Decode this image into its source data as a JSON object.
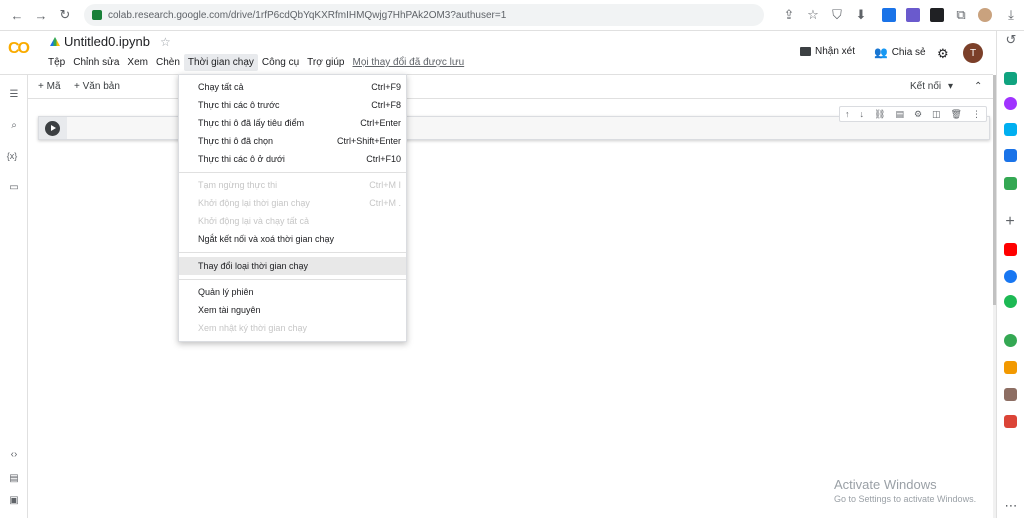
{
  "browser": {
    "url": "colab.research.google.com/drive/1rfP6cdQbYqKXRfmIHMQwjg7HhPAk2OM3?authuser=1"
  },
  "header": {
    "logo": "CO",
    "notebook_title": "Untitled0.ipynb",
    "menus": [
      "Tệp",
      "Chỉnh sửa",
      "Xem",
      "Chèn",
      "Thời gian chạy",
      "Công cụ",
      "Trợ giúp"
    ],
    "last_edit": "Mọi thay đổi đã được lưu",
    "comment_label": "Nhận xét",
    "share_label": "Chia sẻ",
    "avatar_letter": "T"
  },
  "toolbar": {
    "add_code": "+ Mã",
    "add_text": "+ Văn bản",
    "connect": "Kết nối"
  },
  "runtime_menu": {
    "items": [
      {
        "label": "Chạy tất cả",
        "shortcut": "Ctrl+F9",
        "disabled": false
      },
      {
        "label": "Thực thi các ô trước",
        "shortcut": "Ctrl+F8",
        "disabled": false
      },
      {
        "label": "Thực thi ô đã lấy tiêu điểm",
        "shortcut": "Ctrl+Enter",
        "disabled": false
      },
      {
        "label": "Thực thi ô đã chọn",
        "shortcut": "Ctrl+Shift+Enter",
        "disabled": false
      },
      {
        "label": "Thực thi các ô ở dưới",
        "shortcut": "Ctrl+F10",
        "disabled": false
      },
      {
        "label": "Tạm ngừng thực thi",
        "shortcut": "Ctrl+M I",
        "disabled": true
      },
      {
        "label": "Khởi động lại thời gian chạy",
        "shortcut": "Ctrl+M .",
        "disabled": true
      },
      {
        "label": "Khởi động lại và chạy tất cả",
        "shortcut": "",
        "disabled": true
      },
      {
        "label": "Ngắt kết nối và xoá thời gian chạy",
        "shortcut": "",
        "disabled": false
      },
      {
        "label": "Thay đổi loại thời gian chạy",
        "shortcut": "",
        "disabled": false
      },
      {
        "label": "Quản lý phiên",
        "shortcut": "",
        "disabled": false
      },
      {
        "label": "Xem tài nguyên",
        "shortcut": "",
        "disabled": false
      },
      {
        "label": "Xem nhật ký thời gian chạy",
        "shortcut": "",
        "disabled": true
      }
    ]
  },
  "watermark": {
    "title": "Activate Windows",
    "subtitle": "Go to Settings to activate Windows."
  },
  "colors": {
    "accent": "#f9ab00",
    "disabled_text": "#c6c6c6",
    "hover_bg": "#e8e8e8"
  }
}
